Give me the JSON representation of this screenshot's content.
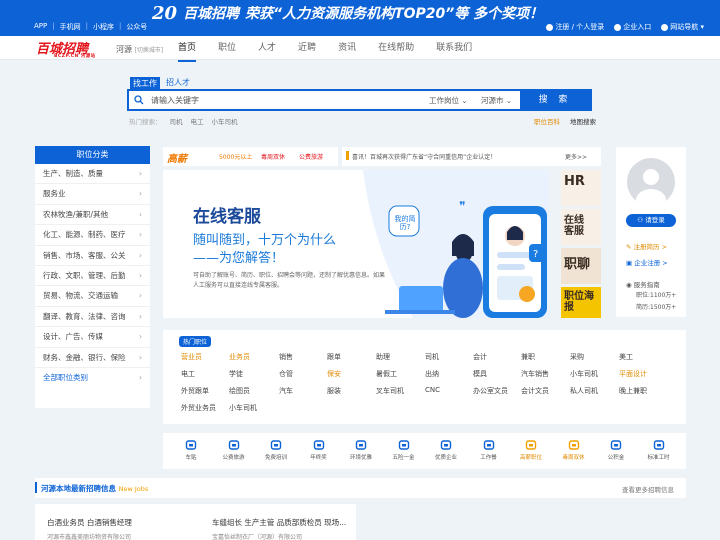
{
  "topbar": {
    "links": [
      "APP",
      "手机网",
      "小程序",
      "公众号"
    ],
    "banner": {
      "num": "20",
      "name": "百城招聘",
      "msg": "荣获“人力资源服务机构TOP20”等 多个奖项！"
    },
    "right": {
      "login": "注册 / 个人登录",
      "company": "企业入口",
      "sitemap": "网站导航"
    }
  },
  "nav": {
    "logo": "百城招聘",
    "logo_sub": "BCZP.CN 河源站",
    "city": "河源",
    "switch_city": "[切换城市]",
    "items": [
      "首页",
      "职位",
      "人才",
      "近聘",
      "资讯",
      "在线帮助",
      "联系我们"
    ]
  },
  "search": {
    "tabs": [
      "找工作",
      "招人才"
    ],
    "placeholder": "请输入关键字",
    "type": "工作岗位",
    "city": "河源市",
    "button": "搜 索",
    "hot_label": "热门搜索：",
    "hot": [
      "司机",
      "电工",
      "小车司机"
    ],
    "links": [
      "职位百科",
      "地图搜索"
    ]
  },
  "categories": {
    "title": "职位分类",
    "items": [
      "生产、制造、质量",
      "服务业",
      "农林牧渔/兼职/其他",
      "化工、能源、制药、医疗",
      "销售、市场、客服、公关",
      "行政、文职、管理、后勤",
      "贸易、物流、交通运输",
      "翻译、教育、法律、咨询",
      "设计、广告、传媒",
      "财务、金融、银行、保险"
    ],
    "all": "全部职位类别"
  },
  "ticker": {
    "logo": "高薪",
    "tags": [
      "5000元以上",
      "毒周双休",
      "公费旅游"
    ]
  },
  "news": {
    "text": "喜讯！百城再次获得广东省“守合同重信用”企业认定！",
    "more": "更多>>"
  },
  "hero": {
    "title": "在线客服",
    "line1": "随叫随到，十万个为什么",
    "line2": "——为您解答！",
    "desc": "可自助了解账号、简历、职位、招聘会等问题，还制了解优惠信息。如果人工服务可以直接连线专属客服。",
    "bubble": "我的简历?"
  },
  "tiles": [
    {
      "text": "HR"
    },
    {
      "text": "在线客服"
    },
    {
      "text": "职聊"
    },
    {
      "text": "职位海报"
    }
  ],
  "user": {
    "login": "请登录",
    "register": "注册简历 >",
    "company": "企业注册 >",
    "stats_label": "服务指南",
    "jobs": "职位:1100万+",
    "resumes": "简历:1500万+"
  },
  "hot_jobs": {
    "label": "热门职位",
    "rows": [
      [
        "营业员",
        "业务员",
        "销售",
        "跟单",
        "助理",
        "司机",
        "会计",
        "兼职",
        "采购",
        "美工"
      ],
      [
        "电工",
        "学徒",
        "仓管",
        "保安",
        "暑假工",
        "出纳",
        "模具",
        "汽车销售",
        "小车司机",
        "平面设计"
      ],
      [
        "外贸跟单",
        "绘图员",
        "汽车",
        "服装",
        "叉车司机",
        "CNC",
        "办公室文员",
        "会计文员",
        "私人司机",
        "晚上兼职"
      ],
      [
        "外贸业务员",
        "小车司机"
      ]
    ]
  },
  "icons": [
    "车贴",
    "公费旅游",
    "免费培训",
    "年终奖",
    "环境优雅",
    "五险一金",
    "优质企业",
    "工作餐",
    "高薪职位",
    "毒周双休",
    "公积金",
    "标准工时"
  ],
  "latest": {
    "title": "河源本地最新招聘信息",
    "en": "New Jobs",
    "more": "查看更多招聘信息"
  },
  "cards": [
    {
      "title": "白酒业务员  白酒销售经理",
      "company": "河源市鑫鑫美丽坊物资有限公司"
    },
    {
      "title": "车缝组长  生产主管  品质部质检员  现场...",
      "company": "宝嘉怡丝制衣厂（河源）有限公司"
    }
  ],
  "colors": {
    "brand": "#0d63d6",
    "accent": "#e08a00",
    "logo": "#e4161d"
  }
}
